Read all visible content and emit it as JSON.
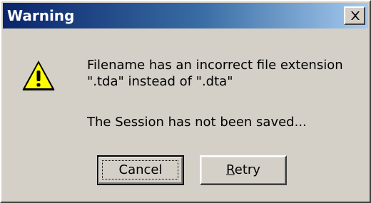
{
  "window": {
    "title": "Warning"
  },
  "icons": {
    "warning": "warning-icon",
    "close": "close-icon"
  },
  "message": {
    "line1": "Filename has an incorrect file extension",
    "line2": "\".tda\" instead of \".dta\"",
    "line3": "The Session has not been saved..."
  },
  "buttons": {
    "cancel_label": "Cancel",
    "retry_mnemonic": "R",
    "retry_rest": "etry"
  },
  "colors": {
    "title_gradient_start": "#0a246a",
    "title_gradient_end": "#a6caf0",
    "dialog_background": "#d4d0c8",
    "warning_yellow": "#ffff00"
  }
}
